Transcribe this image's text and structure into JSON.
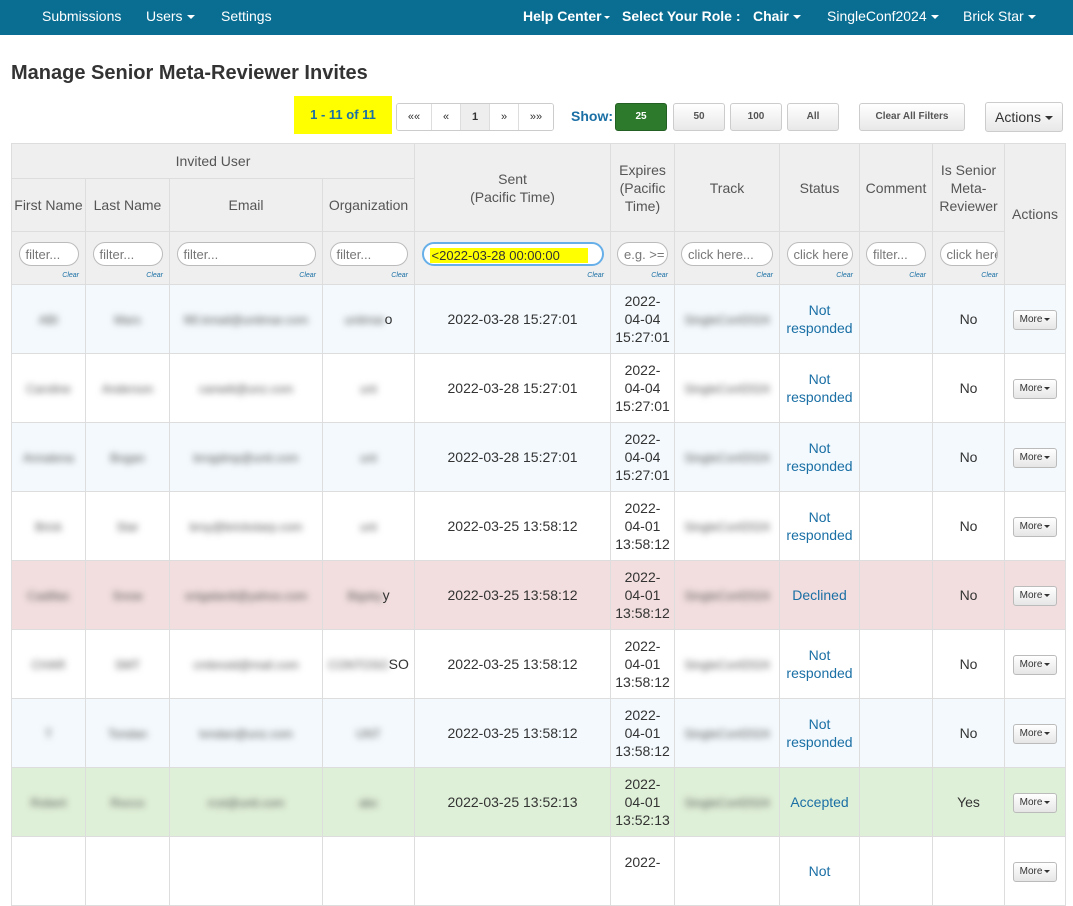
{
  "nav": {
    "submissions": "Submissions",
    "users": "Users",
    "settings": "Settings",
    "help_center": "Help Center",
    "select_role_label": "Select Your Role :",
    "role": "Chair",
    "conference": "SingleConf2024",
    "user": "Brick Star"
  },
  "page_title": "Manage Senior Meta-Reviewer Invites",
  "toolbar": {
    "count": "1 - 11 of 11",
    "pager": {
      "first": "««",
      "prev": "«",
      "page": "1",
      "next": "»",
      "last": "»»"
    },
    "show_label": "Show:",
    "show_options": [
      "25",
      "50",
      "100",
      "All"
    ],
    "show_selected": "25",
    "clear_filters": "Clear All Filters",
    "actions": "Actions"
  },
  "table": {
    "group_header": "Invited User",
    "headers": {
      "first_name": "First Name",
      "last_name": "Last Name",
      "email": "Email",
      "organization": "Organization",
      "sent": "Sent",
      "sent_sub": "(Pacific Time)",
      "expires": "Expires (Pacific Time)",
      "track": "Track",
      "status": "Status",
      "comment": "Comment",
      "is_senior": "Is Senior Meta-Reviewer",
      "actions": "Actions"
    },
    "filters": {
      "first_name": "filter...",
      "last_name": "filter...",
      "email": "filter...",
      "organization": "filter...",
      "sent": "<2022-03-28 00:00:00",
      "expires": "e.g. >=",
      "track": "click here...",
      "status": "click here",
      "comment": "filter...",
      "is_senior": "click here",
      "clear": "Clear"
    },
    "more_label": "More",
    "rows": [
      {
        "first": "ABI",
        "last": "Mars",
        "email": "fil0.kmail@unitmar.com",
        "org": "unitmar",
        "org_suffix": "o",
        "sent": "2022-03-28 15:27:01",
        "exp_a": "2022-",
        "exp_b": "04-04",
        "exp_c": "15:27:01",
        "track": "SingleConf2024",
        "status": "Not responded",
        "comment": "",
        "senior": "No",
        "style": "odd"
      },
      {
        "first": "Caroline",
        "last": "Anderson",
        "email": "canwiti@unz.com",
        "org": "unt",
        "org_suffix": "",
        "sent": "2022-03-28 15:27:01",
        "exp_a": "2022-",
        "exp_b": "04-04",
        "exp_c": "15:27:01",
        "track": "SingleConf2024",
        "status": "Not responded",
        "comment": "",
        "senior": "No",
        "style": "even"
      },
      {
        "first": "Annalena",
        "last": "Bogan",
        "email": "brogdmp@unit.com",
        "org": "unt",
        "org_suffix": "",
        "sent": "2022-03-28 15:27:01",
        "exp_a": "2022-",
        "exp_b": "04-04",
        "exp_c": "15:27:01",
        "track": "SingleConf2024",
        "status": "Not responded",
        "comment": "",
        "senior": "No",
        "style": "odd"
      },
      {
        "first": "Brick",
        "last": "Star",
        "email": "brsy@brickstarp.com",
        "org": "unt",
        "org_suffix": "",
        "sent": "2022-03-25 13:58:12",
        "exp_a": "2022-",
        "exp_b": "04-01",
        "exp_c": "13:58:12",
        "track": "SingleConf2024",
        "status": "Not responded",
        "comment": "",
        "senior": "No",
        "style": "even"
      },
      {
        "first": "Cadillac",
        "last": "Snow",
        "email": "snigalardi@yahoo.com",
        "org": "Bigsky",
        "org_suffix": "y",
        "sent": "2022-03-25 13:58:12",
        "exp_a": "2022-",
        "exp_b": "04-01",
        "exp_c": "13:58:12",
        "track": "SingleConf2024",
        "status": "Declined",
        "comment": "",
        "senior": "No",
        "style": "declined"
      },
      {
        "first": "CHAR",
        "last": "SMT",
        "email": "cmbnoid@mail.com",
        "org": "CONTOSO",
        "org_suffix": "SO",
        "sent": "2022-03-25 13:58:12",
        "exp_a": "2022-",
        "exp_b": "04-01",
        "exp_c": "13:58:12",
        "track": "SingleConf2024",
        "status": "Not responded",
        "comment": "",
        "senior": "No",
        "style": "even"
      },
      {
        "first": "T",
        "last": "Tondan",
        "email": "tvndan@unz.com",
        "org": "UNT",
        "org_suffix": "",
        "sent": "2022-03-25 13:58:12",
        "exp_a": "2022-",
        "exp_b": "04-01",
        "exp_c": "13:58:12",
        "track": "SingleConf2024",
        "status": "Not responded",
        "comment": "",
        "senior": "No",
        "style": "odd"
      },
      {
        "first": "Robert",
        "last": "Rocco",
        "email": "rcst@unit.com",
        "org": "abc",
        "org_suffix": "",
        "sent": "2022-03-25 13:52:13",
        "exp_a": "2022-",
        "exp_b": "04-01",
        "exp_c": "13:52:13",
        "track": "SingleConf2024",
        "status": "Accepted",
        "comment": "",
        "senior": "Yes",
        "style": "accepted"
      },
      {
        "first": "",
        "last": "",
        "email": "",
        "org": "",
        "org_suffix": "",
        "sent": "",
        "exp_a": "2022-",
        "exp_b": "",
        "exp_c": "",
        "track": "",
        "status": "Not",
        "comment": "",
        "senior": "",
        "style": "even"
      }
    ]
  }
}
